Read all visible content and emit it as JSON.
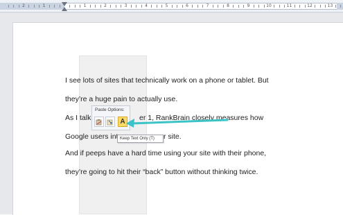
{
  "ruler": {
    "numbers": [
      "2",
      "1",
      "1",
      "2",
      "3",
      "4",
      "5",
      "6",
      "7",
      "8",
      "9",
      "10",
      "11",
      "12",
      "13"
    ]
  },
  "document": {
    "lines": [
      "I see lots of sites that technically work on a phone or tablet. But",
      "they’re a huge pain to actually use.",
      "As I talk",
      "er 1, RankBrain closely measures how",
      "Google users int",
      "r site.",
      "And if peeps have a hard time using your site with their phone,",
      "they’re going to hit their “back” button without thinking twice."
    ]
  },
  "paste_options": {
    "title": "Paste Options:",
    "buttons": [
      {
        "icon": "keep-source-formatting-icon"
      },
      {
        "icon": "merge-formatting-icon"
      },
      {
        "icon": "keep-text-only-icon",
        "label": "A"
      }
    ],
    "tooltip": "Keep Text Only (T)"
  },
  "colors": {
    "arrow": "#3cc3c8",
    "active_button": "#ffd966"
  }
}
